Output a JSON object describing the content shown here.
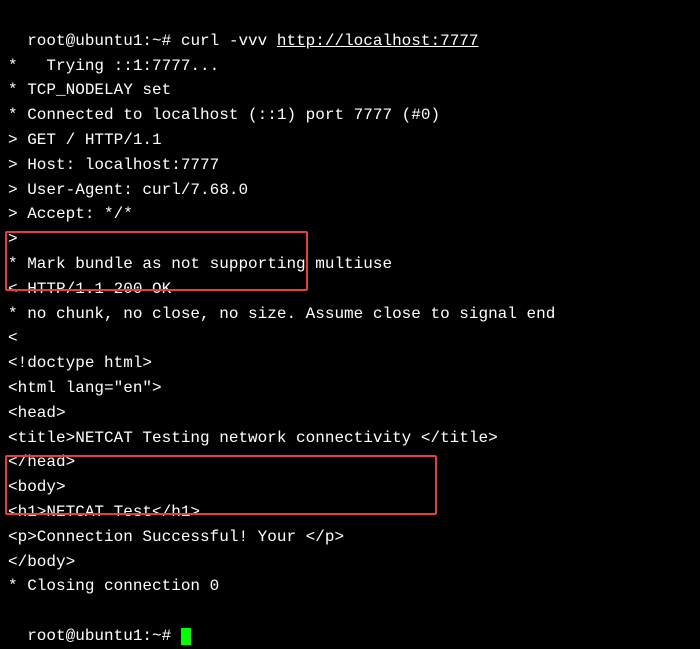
{
  "terminal": {
    "prompt1": "root@ubuntu1:~#",
    "cmd1_a": " curl -vvv ",
    "cmd1_b": "http://localhost:7777",
    "lines": {
      "l1": "*   Trying ::1:7777...",
      "l2": "* TCP_NODELAY set",
      "l3": "* Connected to localhost (::1) port 7777 (#0)",
      "l4": "> GET / HTTP/1.1",
      "l5": "> Host: localhost:7777",
      "l6": "> User-Agent: curl/7.68.0",
      "l7": "> Accept: */*",
      "l8": ">",
      "l9": "* Mark bundle as not supporting multiuse",
      "l10": "< HTTP/1.1 200 OK",
      "l11": "* no chunk, no close, no size. Assume close to signal end",
      "l12": "<",
      "l13": "<!doctype html>",
      "l14": "<html lang=\"en\">",
      "l15": "<head>",
      "l16": "<title>NETCAT Testing network connectivity </title>",
      "l17": "</head>",
      "l18": "<body>",
      "l19": "<h1>NETCAT Test</h1>",
      "l20": "<p>Connection Successful! Your </p>",
      "l21": "</body>",
      "l22": "* Closing connection 0"
    },
    "prompt2": "root@ubuntu1:~# "
  }
}
